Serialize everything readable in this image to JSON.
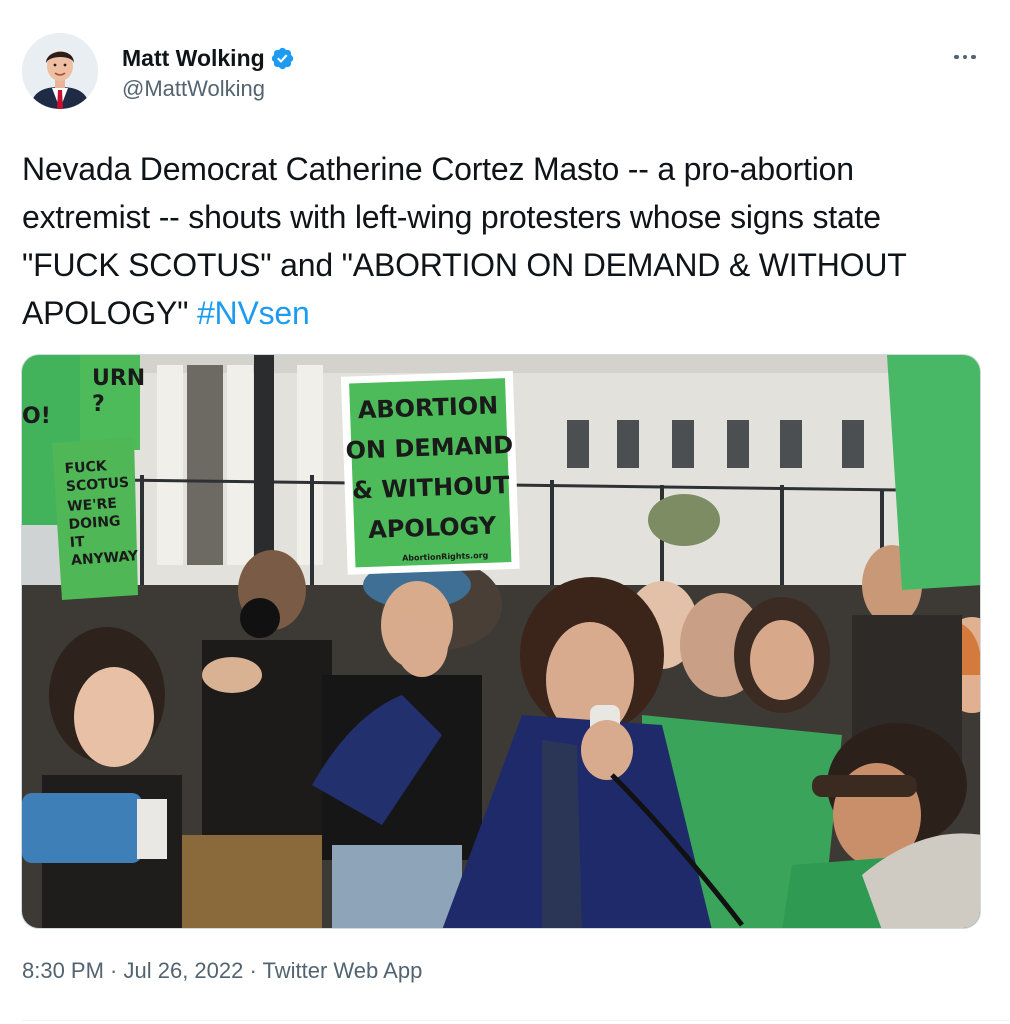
{
  "author": {
    "display_name": "Matt Wolking",
    "handle": "@MattWolking",
    "verified": true,
    "avatar_icon": "person-avatar"
  },
  "tweet": {
    "text_main": "Nevada Democrat Catherine Cortez Masto -- a pro-abortion extremist -- shouts with left-wing protesters whose signs state \"FUCK SCOTUS\" and \"ABORTION ON DEMAND & WITHOUT APOLOGY\" ",
    "hashtag": "#NVsen",
    "time": "8:30 PM",
    "date": "Jul 26, 2022",
    "source": "Twitter Web App",
    "separator": " · "
  },
  "media": {
    "signs": {
      "main_line1": "ABORTION",
      "main_line2": "ON DEMAND",
      "main_line3": "& WITHOUT",
      "main_line4": "APOLOGY",
      "main_small": "AbortionRights.org",
      "left_top1": "URN",
      "left_top2": "?",
      "left_mid": "O!",
      "left_line1": "FUCK",
      "left_line2": "SCOTUS",
      "left_line3": "WE'RE",
      "left_line4": "DOING",
      "left_line5": "IT",
      "left_line6": "ANYWAY"
    }
  },
  "colors": {
    "accent": "#1d9bf0",
    "text": "#0f1419",
    "secondary": "#536471",
    "sign_green": "#4dbb5a"
  },
  "icons": {
    "verified": "verified-badge-icon",
    "more": "more-options-icon"
  }
}
